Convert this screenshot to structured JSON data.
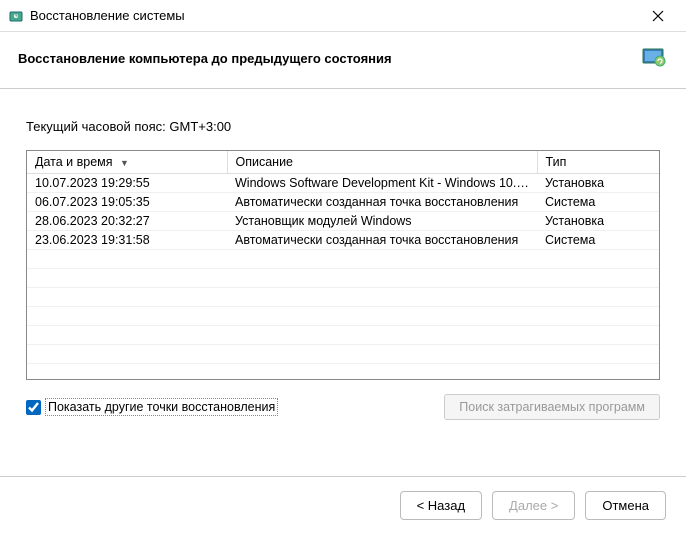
{
  "window": {
    "title": "Восстановление системы"
  },
  "header": {
    "title": "Восстановление компьютера до предыдущего состояния"
  },
  "timezone_label": "Текущий часовой пояс: GMT+3:00",
  "table": {
    "columns": {
      "date": "Дата и время",
      "desc": "Описание",
      "type": "Тип"
    },
    "rows": [
      {
        "date": "10.07.2023 19:29:55",
        "desc": "Windows Software Development Kit - Windows 10.0...",
        "type": "Установка"
      },
      {
        "date": "06.07.2023 19:05:35",
        "desc": "Автоматически созданная точка восстановления",
        "type": "Система"
      },
      {
        "date": "28.06.2023 20:32:27",
        "desc": "Установщик модулей Windows",
        "type": "Установка"
      },
      {
        "date": "23.06.2023 19:31:58",
        "desc": "Автоматически созданная точка восстановления",
        "type": "Система"
      }
    ]
  },
  "checkbox_label": "Показать другие точки восстановления",
  "scan_button": "Поиск затрагиваемых программ",
  "footer": {
    "back": "< Назад",
    "next": "Далее >",
    "cancel": "Отмена"
  }
}
